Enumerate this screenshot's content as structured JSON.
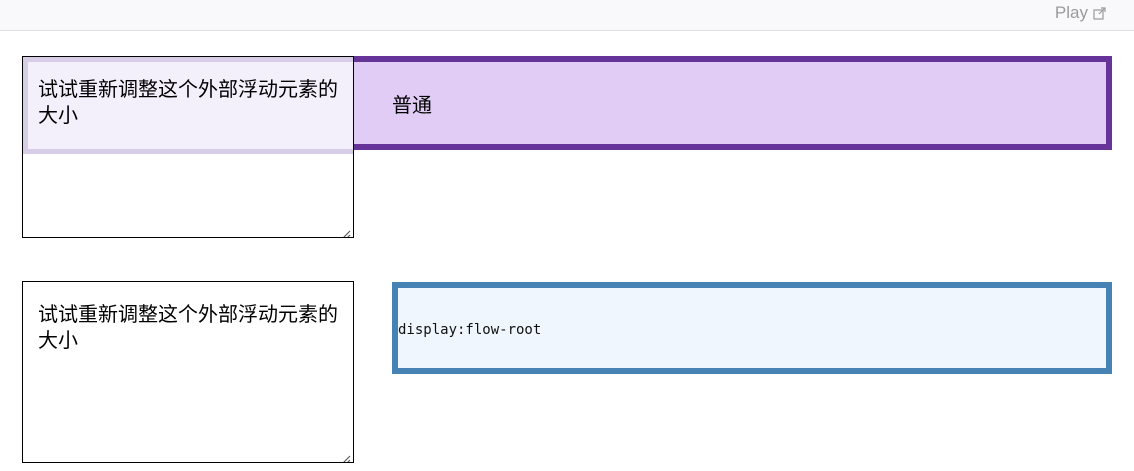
{
  "toolbar": {
    "play_label": "Play"
  },
  "section_normal": {
    "textarea_text": "试试重新调整这个外部浮动元素的大小",
    "box_label": "普通"
  },
  "section_flowroot": {
    "textarea_text": "试试重新调整这个外部浮动元素的大小",
    "box_label": "display:flow-root"
  },
  "colors": {
    "normal_border": "#663399",
    "normal_fill": "#e0ccf4",
    "flowroot_border": "#4682b4",
    "flowroot_fill": "#f0f6fe"
  },
  "icons": {
    "play_link": "external-link-icon",
    "resize": "resize-grip-icon"
  }
}
